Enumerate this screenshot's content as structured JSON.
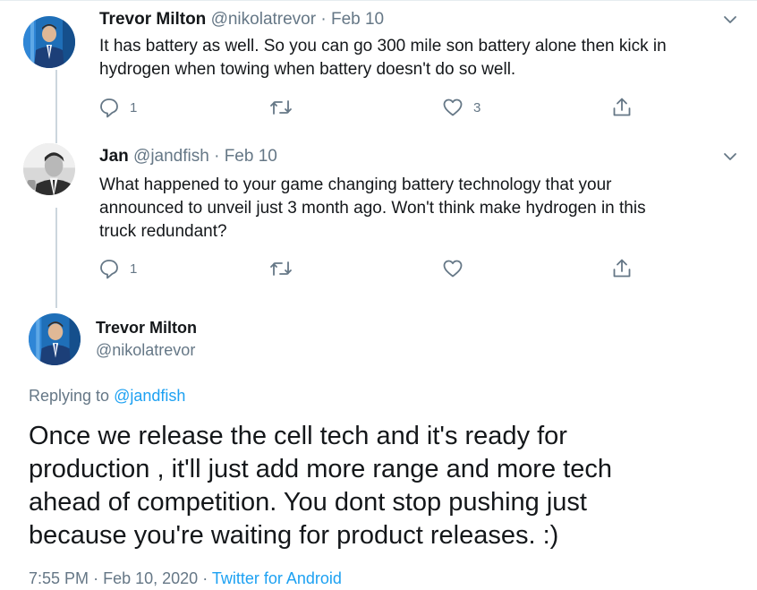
{
  "thread": {
    "tweet1": {
      "name": "Trevor Milton",
      "handle": "@nikolatrevor",
      "separator": "·",
      "date": "Feb 10",
      "text_line1": "It has battery as well. So you can go 300 mile son battery alone then kick in",
      "text_line2": "hydrogen when towing when battery doesn't do so well.",
      "reply_count": "1",
      "retweet_count": "",
      "like_count": "3"
    },
    "tweet2": {
      "name": "Jan",
      "handle": "@jandfish",
      "separator": "·",
      "date": "Feb 10",
      "text_line1": "What happened to your game changing battery technology that your",
      "text_line2": "announced to unveil just 3 month ago. Won't think make hydrogen in this",
      "text_line3": "truck redundant?",
      "reply_count": "1",
      "retweet_count": "",
      "like_count": ""
    }
  },
  "main_tweet": {
    "name": "Trevor Milton",
    "handle": "@nikolatrevor",
    "replying_prefix": "Replying to",
    "replying_to": "@jandfish",
    "text_line1": "Once we release the cell tech and it's ready for",
    "text_line2": "production , it'll just add more range and more tech",
    "text_line3": "ahead of competition. You dont stop pushing just",
    "text_line4": "because you're waiting for product releases. :)",
    "time": "7:55 PM",
    "separator": "·",
    "date": "Feb 10, 2020",
    "source": "Twitter for Android"
  },
  "colors": {
    "text": "#14171a",
    "secondary": "#657786",
    "link": "#1da1f2",
    "thread_line": "#ccd6dd"
  },
  "icons": [
    "reply-icon",
    "retweet-icon",
    "like-icon",
    "share-icon",
    "chevron-down-icon"
  ]
}
